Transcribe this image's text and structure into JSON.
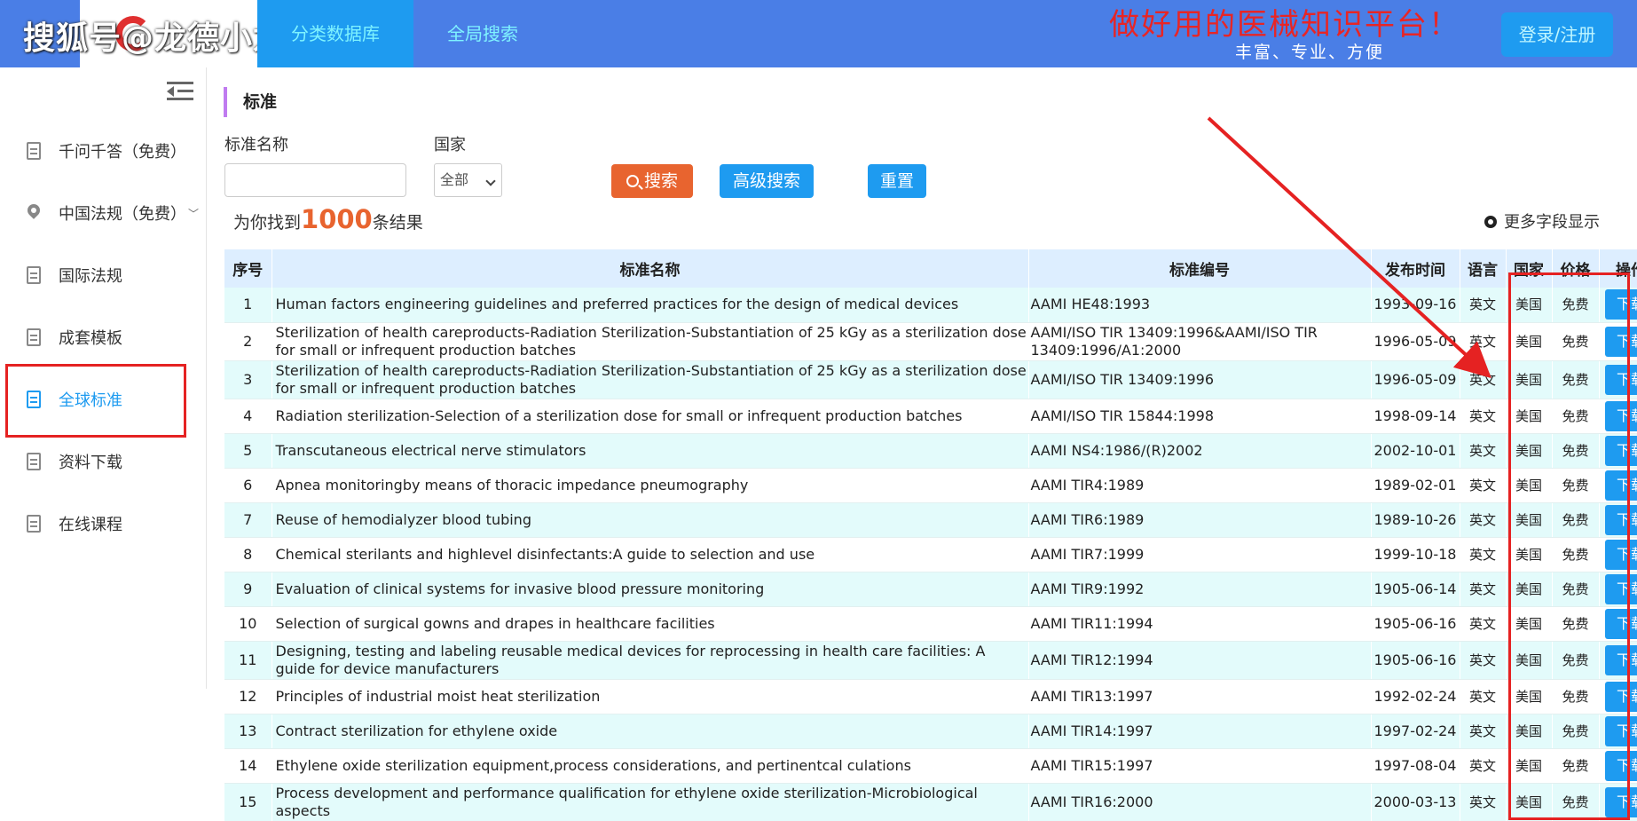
{
  "watermark": "搜狐号@龙德小龙",
  "nav": {
    "category": "分类数据库",
    "search": "全局搜索"
  },
  "slogan": {
    "main": "做好用的医械知识平台！",
    "sub": "丰富、专业、方便"
  },
  "login": "登录/注册",
  "sidebar": {
    "items": [
      {
        "label": "千问千答（免费）"
      },
      {
        "label": "中国法规（免费）",
        "chev": "﹀"
      },
      {
        "label": "国际法规"
      },
      {
        "label": "成套模板"
      },
      {
        "label": "全球标准"
      },
      {
        "label": "资料下载"
      },
      {
        "label": "在线课程"
      }
    ]
  },
  "section": {
    "title": "标准"
  },
  "filters": {
    "name_label": "标准名称",
    "name_value": "",
    "country_label": "国家",
    "country_value": "全部",
    "search_btn": "搜索",
    "advanced_btn": "高级搜索",
    "reset_btn": "重置"
  },
  "results": {
    "prefix": "为你找到",
    "count": "1000",
    "suffix": "条结果"
  },
  "more_fields": "更多字段显示",
  "table": {
    "headers": {
      "no": "序号",
      "name": "标准名称",
      "code": "标准编号",
      "date": "发布时间",
      "lang": "语言",
      "country": "国家",
      "price": "价格",
      "op": "操作"
    },
    "rows": [
      {
        "no": "1",
        "name": "Human factors engineering guidelines and preferred practices for the design of medical devices",
        "code": "AAMI HE48:1993",
        "date": "1993-09-16",
        "lang": "英文",
        "country": "美国",
        "price": "免费",
        "op": "下载"
      },
      {
        "no": "2",
        "name": "Sterilization of health careproducts-Radiation Sterilization-Substantiation of 25 kGy as a sterilization dose for small or infrequent production batches",
        "code": "AAMI/ISO TIR 13409:1996&AAMI/ISO TIR 13409:1996/A1:2000",
        "date": "1996-05-09",
        "lang": "英文",
        "country": "美国",
        "price": "免费",
        "op": "下载"
      },
      {
        "no": "3",
        "name": "Sterilization of health careproducts-Radiation Sterilization-Substantiation of 25 kGy as a sterilization dose for small or infrequent production batches",
        "code": "AAMI/ISO TIR 13409:1996",
        "date": "1996-05-09",
        "lang": "英文",
        "country": "美国",
        "price": "免费",
        "op": "下载"
      },
      {
        "no": "4",
        "name": "Radiation sterilization-Selection of a sterilization dose for small or infrequent production batches",
        "code": "AAMI/ISO TIR 15844:1998",
        "date": "1998-09-14",
        "lang": "英文",
        "country": "美国",
        "price": "免费",
        "op": "下载"
      },
      {
        "no": "5",
        "name": "Transcutaneous electrical nerve stimulators",
        "code": "AAMI NS4:1986/(R)2002",
        "date": "2002-10-01",
        "lang": "英文",
        "country": "美国",
        "price": "免费",
        "op": "下载"
      },
      {
        "no": "6",
        "name": "Apnea monitoringby means of thoracic impedance pneumography",
        "code": "AAMI TIR4:1989",
        "date": "1989-02-01",
        "lang": "英文",
        "country": "美国",
        "price": "免费",
        "op": "下载"
      },
      {
        "no": "7",
        "name": "Reuse of hemodialyzer blood tubing",
        "code": "AAMI TIR6:1989",
        "date": "1989-10-26",
        "lang": "英文",
        "country": "美国",
        "price": "免费",
        "op": "下载"
      },
      {
        "no": "8",
        "name": "Chemical sterilants and highlevel disinfectants:A guide to selection and use",
        "code": "AAMI TIR7:1999",
        "date": "1999-10-18",
        "lang": "英文",
        "country": "美国",
        "price": "免费",
        "op": "下载"
      },
      {
        "no": "9",
        "name": "Evaluation of clinical systems for invasive blood pressure monitoring",
        "code": "AAMI TIR9:1992",
        "date": "1905-06-14",
        "lang": "英文",
        "country": "美国",
        "price": "免费",
        "op": "下载"
      },
      {
        "no": "10",
        "name": "Selection of surgical gowns and drapes in healthcare facilities",
        "code": "AAMI TIR11:1994",
        "date": "1905-06-16",
        "lang": "英文",
        "country": "美国",
        "price": "免费",
        "op": "下载"
      },
      {
        "no": "11",
        "name": "Designing, testing and labeling reusable medical devices for reprocessing in health care facilities: A guide for device manufacturers",
        "code": "AAMI TIR12:1994",
        "date": "1905-06-16",
        "lang": "英文",
        "country": "美国",
        "price": "免费",
        "op": "下载"
      },
      {
        "no": "12",
        "name": "Principles of industrial moist heat sterilization",
        "code": "AAMI TIR13:1997",
        "date": "1992-02-24",
        "lang": "英文",
        "country": "美国",
        "price": "免费",
        "op": "下载"
      },
      {
        "no": "13",
        "name": "Contract sterilization for ethylene oxide",
        "code": "AAMI TIR14:1997",
        "date": "1997-02-24",
        "lang": "英文",
        "country": "美国",
        "price": "免费",
        "op": "下载"
      },
      {
        "no": "14",
        "name": "Ethylene oxide sterilization equipment,process considerations, and pertinentcal culations",
        "code": "AAMI TIR15:1997",
        "date": "1997-08-04",
        "lang": "英文",
        "country": "美国",
        "price": "免费",
        "op": "下载"
      },
      {
        "no": "15",
        "name": "Process development and performance qualification for ethylene oxide sterilization-Microbiological aspects",
        "code": "AAMI TIR16:2000",
        "date": "2000-03-13",
        "lang": "英文",
        "country": "美国",
        "price": "免费",
        "op": "下载"
      }
    ]
  },
  "colors": {
    "topbar": "#4a7ee6",
    "accent": "#1e9bf0",
    "search": "#e8642f",
    "highlight": "#e52222"
  }
}
